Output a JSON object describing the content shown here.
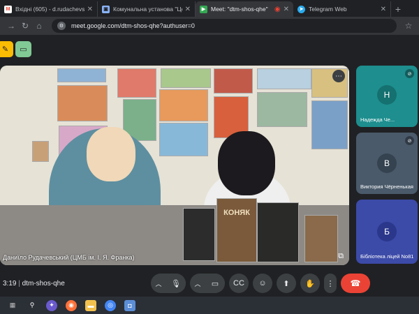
{
  "tabs": [
    {
      "label": "Вхідні (605) - d.rudachevskyi@",
      "icon": "gmail-icon",
      "color": "#ea4335",
      "glyph": "M"
    },
    {
      "label": "Комунальна установа \"Центр",
      "icon": "document-icon",
      "color": "#8ab4f8",
      "glyph": "▣"
    },
    {
      "label": "Meet: \"dtm-shos-qhe\"",
      "icon": "meet-icon",
      "color": "#34a853",
      "glyph": "▶"
    },
    {
      "label": "Telegram Web",
      "icon": "telegram-icon",
      "color": "#2aabee",
      "glyph": "➤"
    }
  ],
  "address": {
    "url": "meet.google.com/dtm-shos-qhe?authuser=0"
  },
  "main_video": {
    "caption": "Даниїло Рудачевський (ЦМБ ім. І. Я. Франка)",
    "book_title": "КОНЯК"
  },
  "participants": [
    {
      "initial": "Н",
      "name": "Надежда Че...",
      "color": "#1e8e8e",
      "avatar_color": "#3aa9a9"
    },
    {
      "initial": "В",
      "name": "Виктория Чёрненькая",
      "color": "#4a5a6a",
      "avatar_color": "#6b7d8e"
    },
    {
      "initial": "Б",
      "name": "Бібліотека ліцей No81",
      "color": "#3c4aa8",
      "avatar_color": "#5a68c9"
    }
  ],
  "bottom": {
    "time": "3:19",
    "meeting_code": "dtm-shos-qhe"
  },
  "colors": {
    "end_call": "#ea4335"
  }
}
